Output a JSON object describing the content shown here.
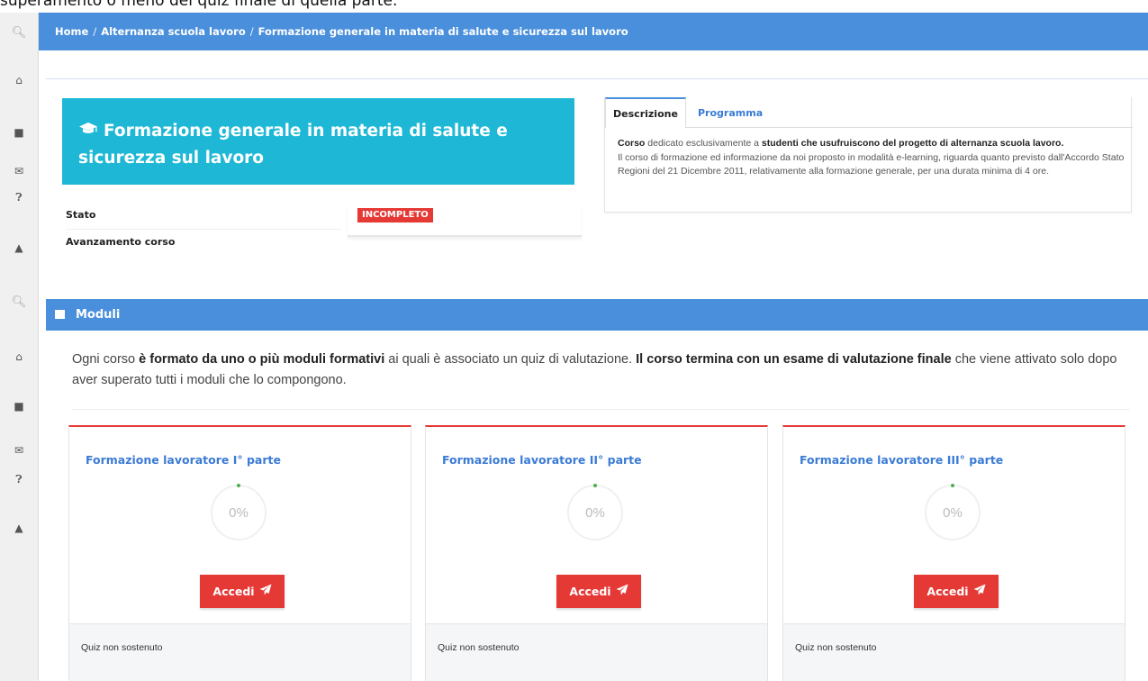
{
  "top_caption": "superamento o meno del quiz finale di quella parte.",
  "sidebar_icons": [
    "search-icon",
    "home-icon",
    "book-icon",
    "envelope-icon",
    "question-icon",
    "user-icon"
  ],
  "breadcrumb": {
    "home": "Home",
    "section": "Alternanza scuola lavoro",
    "current": "Formazione generale in materia di salute e sicurezza sul lavoro",
    "separator": "/"
  },
  "course": {
    "title": "Formazione generale in materia di salute e sicurezza sul lavoro",
    "icon": "graduation-cap-icon",
    "hero_color": "#1eb8d6",
    "stato_label": "Stato",
    "stato_value": "INCOMPLETO",
    "avanzamento_label": "Avanzamento corso"
  },
  "tabs": {
    "active": "Descrizione",
    "inactive": "Programma"
  },
  "description": {
    "p1_bold1": "Corso",
    "p1_text1": " dedicato esclusivamente a ",
    "p1_bold2": "studenti che usufruiscono del progetto di alternanza scuola lavoro.",
    "p2": "Il corso di formazione ed informazione da noi proposto in modalità e-learning, riguarda quanto previsto dall'Accordo Stato Regioni del 21 Dicembre 2011, relativamente alla formazione generale, per una durata minima di 4 ore."
  },
  "moduli": {
    "header": "Moduli",
    "intro_1": "Ogni corso ",
    "intro_b1": "è formato da uno o più moduli formativi",
    "intro_2": " ai quali è associato un quiz di valutazione. ",
    "intro_b2": "Il corso termina con un esame di valutazione finale",
    "intro_3": " che viene attivato solo dopo aver superato tutti i moduli che lo compongono.",
    "cards": [
      {
        "title": "Formazione lavoratore I° parte",
        "progress_text": "0%",
        "progress": 0,
        "button": "Accedi",
        "quiz_status": "Quiz non sostenuto"
      },
      {
        "title": "Formazione lavoratore II° parte",
        "progress_text": "0%",
        "progress": 0,
        "button": "Accedi",
        "quiz_status": "Quiz non sostenuto"
      },
      {
        "title": "Formazione lavoratore III° parte",
        "progress_text": "0%",
        "progress": 0,
        "button": "Accedi",
        "quiz_status": "Quiz non sostenuto"
      }
    ]
  },
  "colors": {
    "primary": "#4a8fdb",
    "danger": "#e53935",
    "link": "#3a7bd5",
    "progress_dot": "#4caf50"
  }
}
